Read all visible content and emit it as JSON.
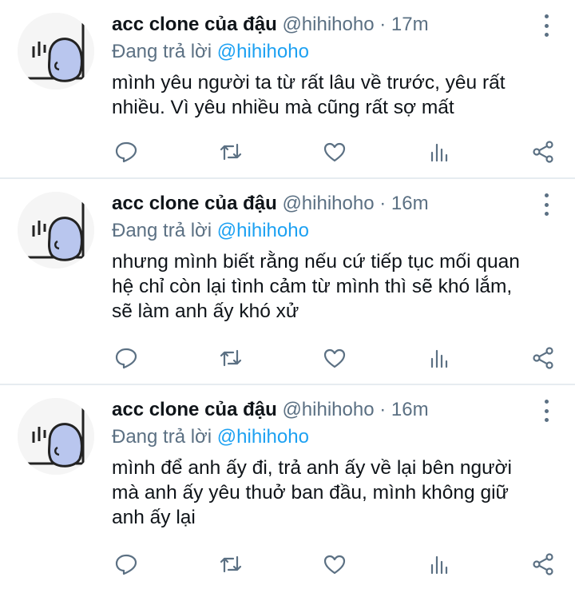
{
  "tweets": [
    {
      "name": "acc clone của đậu",
      "handle": "@hihihoho",
      "separator": "·",
      "time": "17m",
      "reply_prefix": "Đang trả lời",
      "reply_to": "@hihihoho",
      "text_lines": [
        "mình yêu người ta từ rất lâu về trước, yêu rất",
        "nhiều. Vì yêu nhiều mà cũng rất sợ mất"
      ]
    },
    {
      "name": "acc clone của đậu",
      "handle": "@hihihoho",
      "separator": "·",
      "time": "16m",
      "reply_prefix": "Đang trả lời",
      "reply_to": "@hihihoho",
      "text_lines": [
        "nhưng mình biết rằng nếu cứ tiếp tục mối quan",
        "hệ chỉ còn lại tình cảm từ mình thì sẽ khó lắm,",
        "sẽ làm anh ấy khó xử"
      ]
    },
    {
      "name": "acc clone của đậu",
      "handle": "@hihihoho",
      "separator": "·",
      "time": "16m",
      "reply_prefix": "Đang trả lời",
      "reply_to": "@hihihoho",
      "text_lines": [
        "mình để anh ấy đi, trả anh ấy về lại bên người",
        "mà anh ấy yêu thuở ban đầu, mình không giữ",
        "anh ấy lại"
      ]
    }
  ],
  "icons": {
    "reply": "reply-icon",
    "retweet": "retweet-icon",
    "like": "heart-icon",
    "analytics": "analytics-icon",
    "share": "share-icon",
    "more": "more-vertical-icon"
  },
  "colors": {
    "text": "#0f1419",
    "secondary": "#5b7083",
    "mention": "#1da1f2",
    "divider": "#e6ecf0",
    "avatar_fill": "#b9c6ee"
  }
}
